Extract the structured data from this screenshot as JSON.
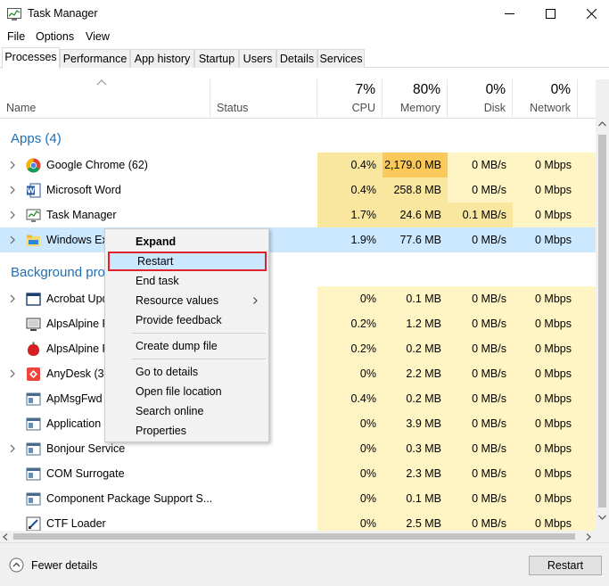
{
  "window": {
    "title": "Task Manager"
  },
  "menu": [
    "File",
    "Options",
    "View"
  ],
  "tabs": [
    "Processes",
    "Performance",
    "App history",
    "Startup",
    "Users",
    "Details",
    "Services"
  ],
  "columns": {
    "name": "Name",
    "status": "Status",
    "cpu": {
      "pct": "7%",
      "label": "CPU"
    },
    "memory": {
      "pct": "80%",
      "label": "Memory"
    },
    "disk": {
      "pct": "0%",
      "label": "Disk"
    },
    "network": {
      "pct": "0%",
      "label": "Network"
    }
  },
  "groups": {
    "apps": "Apps (4)",
    "background": "Background processes"
  },
  "rows": [
    {
      "name": "Google Chrome (62)",
      "icon": "chrome-icon",
      "expand": true,
      "cpu": "0.4%",
      "memory": "2,179.0 MB",
      "disk": "0 MB/s",
      "network": "0 Mbps"
    },
    {
      "name": "Microsoft Word",
      "icon": "word-icon",
      "expand": true,
      "cpu": "0.4%",
      "memory": "258.8 MB",
      "disk": "0 MB/s",
      "network": "0 Mbps"
    },
    {
      "name": "Task Manager",
      "icon": "task-manager-icon",
      "expand": true,
      "cpu": "1.7%",
      "memory": "24.6 MB",
      "disk": "0.1 MB/s",
      "network": "0 Mbps"
    },
    {
      "name": "Windows Explorer",
      "icon": "folder-icon",
      "expand": true,
      "cpu": "1.9%",
      "memory": "77.6 MB",
      "disk": "0 MB/s",
      "network": "0 Mbps",
      "selected": true
    },
    {
      "name": "Acrobat Update Service",
      "icon": "service-window-icon",
      "expand": true,
      "cpu": "0%",
      "memory": "0.1 MB",
      "disk": "0 MB/s",
      "network": "0 Mbps"
    },
    {
      "name": "AlpsAlpine Pointing-device Driver",
      "icon": "monitor-icon",
      "expand": false,
      "cpu": "0.2%",
      "memory": "1.2 MB",
      "disk": "0 MB/s",
      "network": "0 Mbps"
    },
    {
      "name": "AlpsAlpine Pointing-device Driver",
      "icon": "alps-icon",
      "expand": false,
      "cpu": "0.2%",
      "memory": "0.2 MB",
      "disk": "0 MB/s",
      "network": "0 Mbps"
    },
    {
      "name": "AnyDesk (32 bit)",
      "icon": "anydesk-icon",
      "expand": true,
      "cpu": "0%",
      "memory": "2.2 MB",
      "disk": "0 MB/s",
      "network": "0 Mbps"
    },
    {
      "name": "ApMsgFwd",
      "icon": "app-window-icon",
      "expand": false,
      "cpu": "0.4%",
      "memory": "0.2 MB",
      "disk": "0 MB/s",
      "network": "0 Mbps"
    },
    {
      "name": "Application Frame Host",
      "icon": "app-window-icon",
      "expand": false,
      "cpu": "0%",
      "memory": "3.9 MB",
      "disk": "0 MB/s",
      "network": "0 Mbps"
    },
    {
      "name": "Bonjour Service",
      "icon": "app-window-icon",
      "expand": true,
      "cpu": "0%",
      "memory": "0.3 MB",
      "disk": "0 MB/s",
      "network": "0 Mbps"
    },
    {
      "name": "COM Surrogate",
      "icon": "app-window-icon",
      "expand": false,
      "cpu": "0%",
      "memory": "2.3 MB",
      "disk": "0 MB/s",
      "network": "0 Mbps"
    },
    {
      "name": "Component Package Support S...",
      "icon": "app-window-icon",
      "expand": false,
      "cpu": "0%",
      "memory": "0.1 MB",
      "disk": "0 MB/s",
      "network": "0 Mbps"
    },
    {
      "name": "CTF Loader",
      "icon": "ctf-icon",
      "expand": false,
      "cpu": "0%",
      "memory": "2.5 MB",
      "disk": "0 MB/s",
      "network": "0 Mbps"
    }
  ],
  "context_menu": {
    "expand": "Expand",
    "restart": "Restart",
    "end_task": "End task",
    "resource_values": "Resource values",
    "provide_feedback": "Provide feedback",
    "create_dump": "Create dump file",
    "go_to_details": "Go to details",
    "open_location": "Open file location",
    "search_online": "Search online",
    "properties": "Properties"
  },
  "footer": {
    "fewer_details": "Fewer details",
    "restart_button": "Restart"
  },
  "colors": {
    "accent": "#1f6fb5",
    "heat_low": "#fff4c4",
    "heat_mid": "#f9e79f",
    "heat_high": "#fbc85a",
    "selection": "#cce8ff",
    "highlight_border": "#e0202a"
  }
}
